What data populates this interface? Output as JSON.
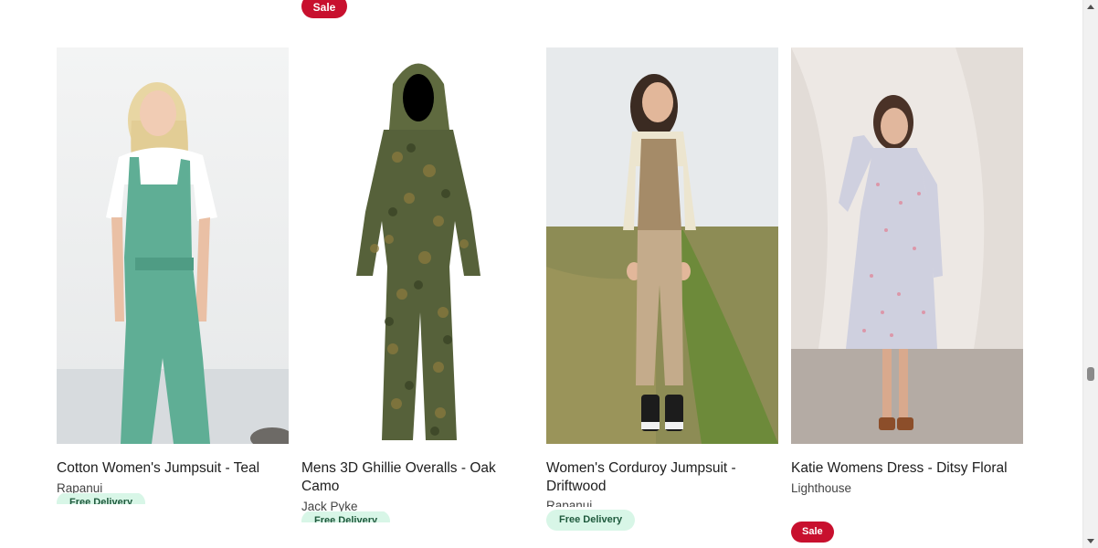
{
  "top_badge": "Sale",
  "products": [
    {
      "title": "Cotton Women's Jumpsuit - Teal",
      "brand": "Rapanui",
      "badge": "Free Delivery"
    },
    {
      "title": "Mens 3D Ghillie Overalls - Oak Camo",
      "brand": "Jack Pyke",
      "badge": "Free Delivery"
    },
    {
      "title": "Women's Corduroy Jumpsuit - Driftwood",
      "brand": "Rapanui",
      "badge": "Free Delivery"
    },
    {
      "title": "Katie Womens Dress - Ditsy Floral",
      "brand": "Lighthouse",
      "badge": "Sale"
    }
  ],
  "colors": {
    "sale": "#c8102e",
    "delivery_bg": "#d8f6e7",
    "delivery_text": "#1f5a3d"
  }
}
